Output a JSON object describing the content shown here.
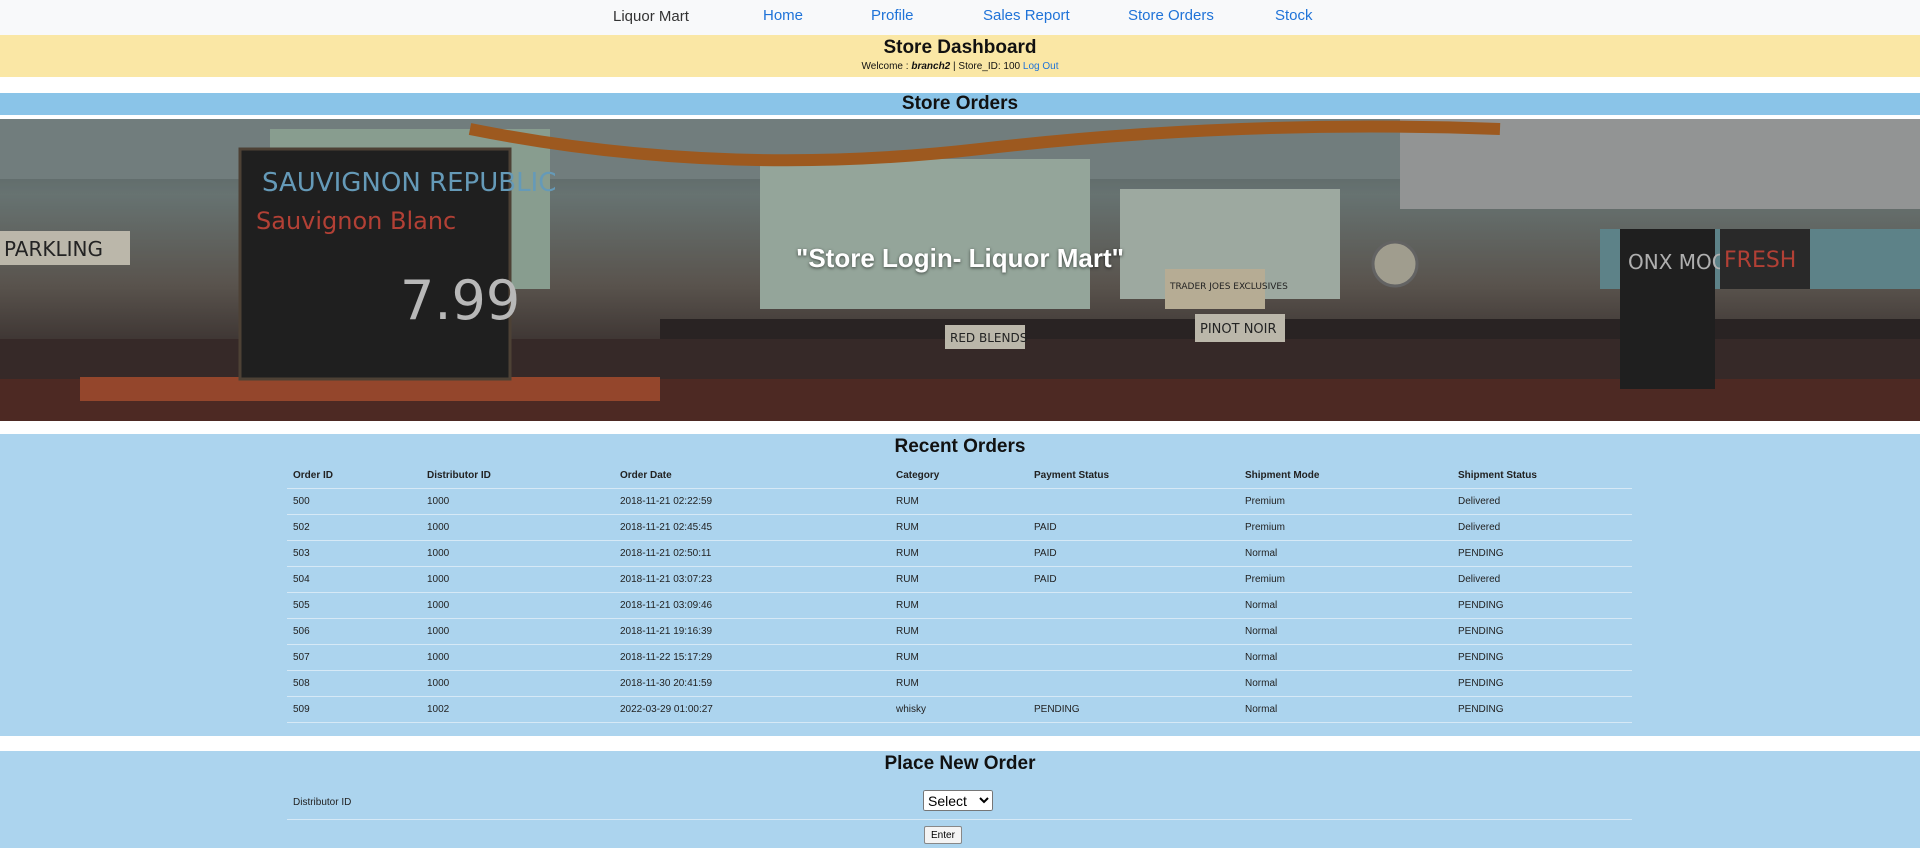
{
  "nav": {
    "brand": "Liquor Mart",
    "items": [
      "Home",
      "Profile",
      "Sales Report",
      "Store Orders",
      "Stock"
    ]
  },
  "dashboard": {
    "title": "Store Dashboard",
    "welcome_prefix": "Welcome :",
    "username": "branch2",
    "store_text": "| Store_ID: 100",
    "logout": "Log Out"
  },
  "store_orders_title": "Store Orders",
  "hero": {
    "caption": "\"Store Login- Liquor Mart\"",
    "signs": [
      "SAUVIGNON REPUBLIC",
      "Sauvignon Blanc",
      "7.99",
      "PARKLING",
      "RED BLENDS",
      "PINOT NOIR",
      "TRADER JOES EXCLUSIVES",
      "ONX MOON",
      "FRESH"
    ]
  },
  "recent_orders": {
    "title": "Recent Orders",
    "columns": [
      "Order ID",
      "Distributor ID",
      "Order Date",
      "Category",
      "Payment Status",
      "Shipment Mode",
      "Shipment Status"
    ],
    "rows": [
      [
        "500",
        "1000",
        "2018-11-21 02:22:59",
        "RUM",
        "",
        "Premium",
        "Delivered"
      ],
      [
        "502",
        "1000",
        "2018-11-21 02:45:45",
        "RUM",
        "PAID",
        "Premium",
        "Delivered"
      ],
      [
        "503",
        "1000",
        "2018-11-21 02:50:11",
        "RUM",
        "PAID",
        "Normal",
        "PENDING"
      ],
      [
        "504",
        "1000",
        "2018-11-21 03:07:23",
        "RUM",
        "PAID",
        "Premium",
        "Delivered"
      ],
      [
        "505",
        "1000",
        "2018-11-21 03:09:46",
        "RUM",
        "",
        "Normal",
        "PENDING"
      ],
      [
        "506",
        "1000",
        "2018-11-21 19:16:39",
        "RUM",
        "",
        "Normal",
        "PENDING"
      ],
      [
        "507",
        "1000",
        "2018-11-22 15:17:29",
        "RUM",
        "",
        "Normal",
        "PENDING"
      ],
      [
        "508",
        "1000",
        "2018-11-30 20:41:59",
        "RUM",
        "",
        "Normal",
        "PENDING"
      ],
      [
        "509",
        "1002",
        "2022-03-29 01:00:27",
        "whisky",
        "PENDING",
        "Normal",
        "PENDING"
      ]
    ]
  },
  "place_order": {
    "title": "Place New Order",
    "distributor_label": "Distributor ID",
    "select_value": "Select",
    "enter_label": "Enter"
  }
}
